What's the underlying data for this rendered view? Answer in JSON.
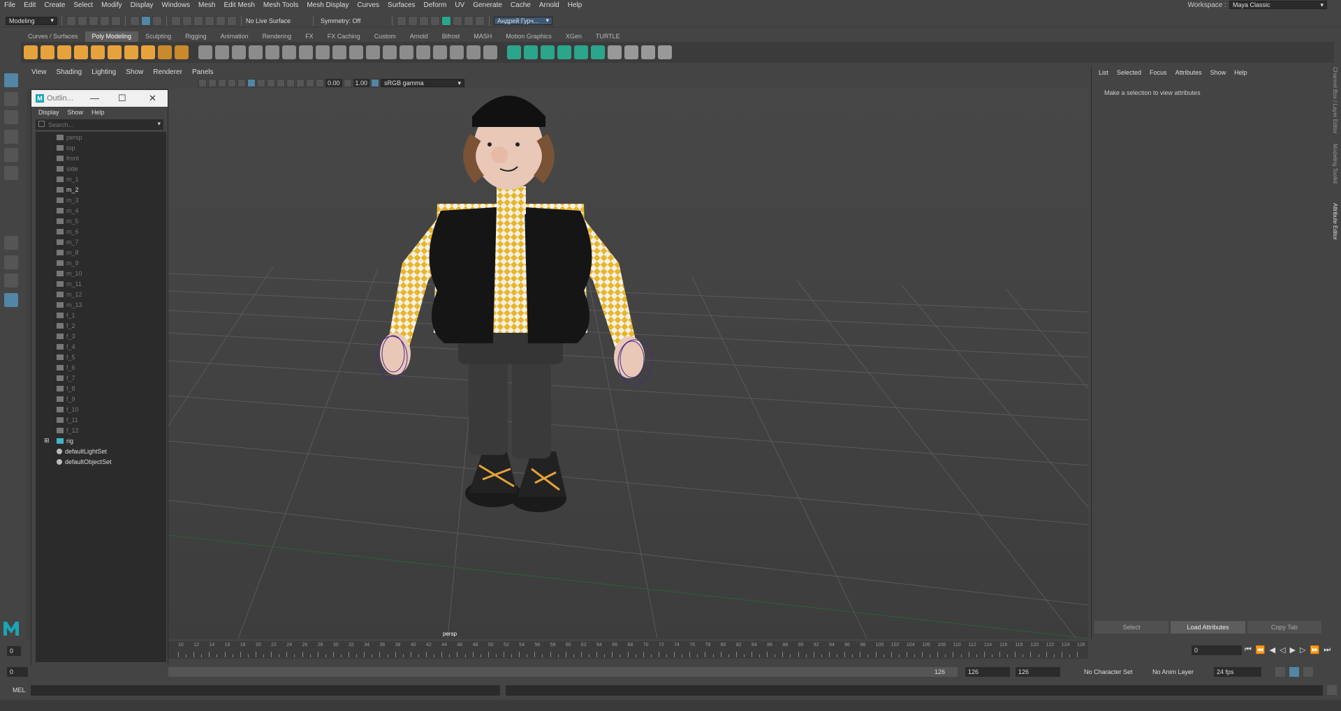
{
  "main_menu": [
    "File",
    "Edit",
    "Create",
    "Select",
    "Modify",
    "Display",
    "Windows",
    "Mesh",
    "Edit Mesh",
    "Mesh Tools",
    "Mesh Display",
    "Curves",
    "Surfaces",
    "Deform",
    "UV",
    "Generate",
    "Cache",
    "Arnold",
    "Help"
  ],
  "workspace": {
    "label": "Workspace :",
    "value": "Maya Classic"
  },
  "status_line": {
    "mode": "Modeling",
    "live_surface": "No Live Surface",
    "symmetry": "Symmetry: Off",
    "user": "Андрей Гурч..."
  },
  "shelf_tabs": [
    "Curves / Surfaces",
    "Poly Modeling",
    "Sculpting",
    "Rigging",
    "Animation",
    "Rendering",
    "FX",
    "FX Caching",
    "Custom",
    "Arnold",
    "Bifrost",
    "MASH",
    "Motion Graphics",
    "XGen",
    "TURTLE"
  ],
  "shelf_active_tab": "Poly Modeling",
  "viewport": {
    "menu": [
      "View",
      "Shading",
      "Lighting",
      "Show",
      "Renderer",
      "Panels"
    ],
    "exposure": "0.00",
    "gamma": "1.00",
    "color_space": "sRGB gamma",
    "camera_label": "persp"
  },
  "outliner": {
    "title": "Outlin...",
    "menu": [
      "Display",
      "Show",
      "Help"
    ],
    "search_placeholder": "Search...",
    "items": [
      {
        "label": "persp",
        "type": "camera"
      },
      {
        "label": "top",
        "type": "camera"
      },
      {
        "label": "front",
        "type": "camera"
      },
      {
        "label": "side",
        "type": "camera"
      },
      {
        "label": "m_1",
        "type": "mesh"
      },
      {
        "label": "m_2",
        "type": "mesh",
        "bright": true
      },
      {
        "label": "m_3",
        "type": "mesh"
      },
      {
        "label": "m_4",
        "type": "mesh"
      },
      {
        "label": "m_5",
        "type": "mesh"
      },
      {
        "label": "m_6",
        "type": "mesh"
      },
      {
        "label": "m_7",
        "type": "mesh"
      },
      {
        "label": "m_8",
        "type": "mesh"
      },
      {
        "label": "m_9",
        "type": "mesh"
      },
      {
        "label": "m_10",
        "type": "mesh"
      },
      {
        "label": "m_11",
        "type": "mesh"
      },
      {
        "label": "m_12",
        "type": "mesh"
      },
      {
        "label": "m_13",
        "type": "mesh"
      },
      {
        "label": "f_1",
        "type": "mesh"
      },
      {
        "label": "f_2",
        "type": "mesh"
      },
      {
        "label": "f_3",
        "type": "mesh"
      },
      {
        "label": "f_4",
        "type": "mesh"
      },
      {
        "label": "f_5",
        "type": "mesh"
      },
      {
        "label": "f_6",
        "type": "mesh"
      },
      {
        "label": "f_7",
        "type": "mesh"
      },
      {
        "label": "f_8",
        "type": "mesh"
      },
      {
        "label": "f_9",
        "type": "mesh"
      },
      {
        "label": "f_10",
        "type": "mesh"
      },
      {
        "label": "f_11",
        "type": "mesh"
      },
      {
        "label": "f_12",
        "type": "mesh"
      },
      {
        "label": "rig",
        "type": "joint",
        "bright": true,
        "expandable": true
      },
      {
        "label": "defaultLightSet",
        "type": "set",
        "bright": true
      },
      {
        "label": "defaultObjectSet",
        "type": "set",
        "bright": true
      }
    ]
  },
  "attribute_editor": {
    "menu": [
      "List",
      "Selected",
      "Focus",
      "Attributes",
      "Show",
      "Help"
    ],
    "message": "Make a selection to view attributes",
    "buttons": [
      "Select",
      "Load Attributes",
      "Copy Tab"
    ],
    "side_tabs": [
      "Channel Box / Layer Editor",
      "Modeling Toolkit",
      "Attribute Editor"
    ]
  },
  "timeline": {
    "ticks": [
      "10",
      "12",
      "14",
      "16",
      "18",
      "20",
      "22",
      "24",
      "26",
      "28",
      "30",
      "32",
      "34",
      "36",
      "38",
      "40",
      "42",
      "44",
      "46",
      "48",
      "50",
      "52",
      "54",
      "56",
      "58",
      "60",
      "62",
      "64",
      "66",
      "68",
      "70",
      "72",
      "74",
      "76",
      "78",
      "80",
      "82",
      "84",
      "86",
      "88",
      "90",
      "92",
      "94",
      "96",
      "98",
      "100",
      "102",
      "104",
      "106",
      "108",
      "110",
      "112",
      "114",
      "116",
      "118",
      "120",
      "122",
      "124",
      "126"
    ],
    "current_frame": "0",
    "start_field": "0",
    "range_start": "0",
    "range_end_slider": "126",
    "range_end": "126",
    "anim_end": "126"
  },
  "range_bar": {
    "character_set": "No Character Set",
    "anim_layer": "No Anim Layer",
    "fps": "24 fps"
  },
  "command_line": {
    "label": "MEL"
  },
  "colors": {
    "accent": "#5285a6",
    "shelf_orange": "#e6a23c",
    "shelf_teal": "#2ca58d",
    "checker_yellow": "#e8b62a"
  }
}
